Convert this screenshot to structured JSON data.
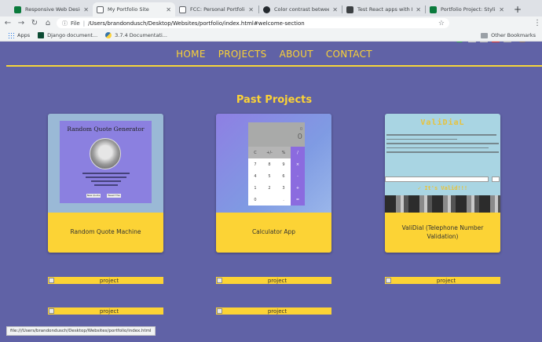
{
  "browser": {
    "tabs": [
      {
        "label": "Responsive Web Design Pro",
        "favicon_color": "#0a7a3c",
        "active": false
      },
      {
        "label": "My Portfolio Site",
        "favicon_color": "#5f6368",
        "active": true
      },
      {
        "label": "FCC: Personal Portfolio",
        "favicon_color": "#5f6368",
        "active": false
      },
      {
        "label": "Color contrast between cod",
        "favicon_color": "#24292e",
        "active": false
      },
      {
        "label": "Test React apps with React",
        "favicon_color": "#3c4043",
        "active": false
      },
      {
        "label": "Portfolio Project: Styling the",
        "favicon_color": "#0a7a3c",
        "active": false
      }
    ],
    "new_tab_label": "+",
    "address": {
      "scheme_label": "File",
      "path": "/Users/brandondusch/Desktop/Websites/portfolio/index.html#welcome-section"
    },
    "bookmarks": {
      "apps_label": "Apps",
      "items": [
        "Django document...",
        "3.7.4 Documentati..."
      ],
      "other_label": "Other Bookmarks"
    },
    "status_url": "file:///Users/brandondusch/Desktop/Websites/portfolio/index.html"
  },
  "nav": {
    "links": [
      "HOME",
      "PROJECTS",
      "ABOUT",
      "CONTACT"
    ]
  },
  "projects": {
    "title": "Past Projects",
    "cards": [
      {
        "caption": "Random Quote Machine"
      },
      {
        "caption": "Calculator App"
      },
      {
        "caption": "ValiDial (Telephone Number Validation)"
      }
    ],
    "quote_thumb": {
      "title": "Random Quote Generator",
      "btn_new": "New Quote",
      "btn_tweet": "Tweet This"
    },
    "calc_thumb": {
      "display_top": "0",
      "display": "0",
      "keys": [
        "C",
        "+/-",
        "%",
        "/",
        "7",
        "8",
        "9",
        "×",
        "4",
        "5",
        "6",
        "-",
        "1",
        "2",
        "3",
        "+",
        "0",
        "",
        ".",
        "="
      ]
    },
    "validial_thumb": {
      "title": "ValiDiaL",
      "result": "✓ It's Valid!!!"
    },
    "broken_label": "project"
  },
  "colors": {
    "page_bg": "#6062a6",
    "accent": "#fcd335"
  }
}
